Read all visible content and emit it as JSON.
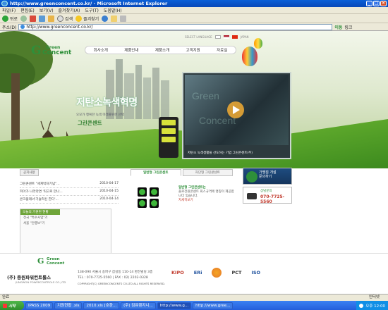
{
  "window": {
    "title": "http://www.greenconcent.co.kr/ - Microsoft Internet Explorer"
  },
  "menu": [
    "파일(F)",
    "편집(E)",
    "보기(V)",
    "즐겨찾기(A)",
    "도구(T)",
    "도움말(H)"
  ],
  "toolbar": {
    "back": "뒤로",
    "search": "검색",
    "favorites": "즐겨찾기"
  },
  "address": {
    "label": "주소(D)",
    "url": "http://www.greenconcent.co.kr/",
    "go": "이동",
    "links": "링크"
  },
  "site": {
    "logo": {
      "top": "Green",
      "bottom": "Concent"
    },
    "lang_label": "SELECT LANGUAGE",
    "lang_extra": "JAPAN",
    "nav": [
      "회사소개",
      "제품안내",
      "제품소개",
      "고객지원",
      "자료실"
    ],
    "slogan": "저탄소녹색혁명",
    "slogan_sub": "오모가 행복한 녹색 미래를위한 선택",
    "brand": "그린콘센트",
    "video_caption": "저탄소 녹색생활을 선도하는 기업 그린콘센트(주)",
    "news": {
      "tab": "공지사항",
      "items": [
        {
          "title": "그린콘센트 \"세계박자기념\"...",
          "date": "2010-04-17"
        },
        {
          "title": "피아가 나라라면 '최고로 만나...",
          "date": "2010-04-15"
        },
        {
          "title": "콘크플레너'기술혁신 한다'...",
          "date": "2010-04-14"
        }
      ]
    },
    "rss": {
      "title": "오늘의 기원된 현황",
      "lines": [
        "전국 \"특수사업\"기",
        "서울 \"안행보\"기"
      ]
    },
    "product_tabs": [
      "일반형 그린콘센트",
      "차단형 그린콘센트"
    ],
    "product": {
      "title": "일반형 그린콘센트는",
      "desc": "플로전원콘센트 회스규격에 명칭이 제공합니다 있습니다.",
      "more": "자세히보기"
    },
    "side": {
      "consult": "가맹점 개설\n문의하기",
      "tel_label": "상담문의",
      "tel": "070-7725-5560"
    },
    "footer": {
      "logo_top": "Green",
      "logo_bottom": "Concent",
      "company": "(주) 중원파워컨트롤스",
      "company_en": "JUNGWON POWERCONTROLS CO.,LTD",
      "address": "138-090 서울시 송파구 잠실동 110-14 명진빌딩 3층",
      "contact": "TEL : 070-7725-5560  |  FAX : 02) 2202-0328",
      "copyright": "COPYRIGHT(C) GREENCONCENTS CO.LTD ALL RIGHTS RESERVED.",
      "certs": [
        "KIPO",
        "ERi",
        "PCT",
        "ISO"
      ]
    }
  },
  "status": {
    "text": "완료",
    "zone": "인터넷"
  },
  "taskbar": {
    "start": "시작",
    "tasks": [
      "IPASS 2009",
      "지원현황 .xls",
      "2010.xls [호환...",
      "(주) 컴퓨텐지니...",
      "http://www.g...",
      "http://www.gree..."
    ],
    "clock": "오후 12:00"
  }
}
